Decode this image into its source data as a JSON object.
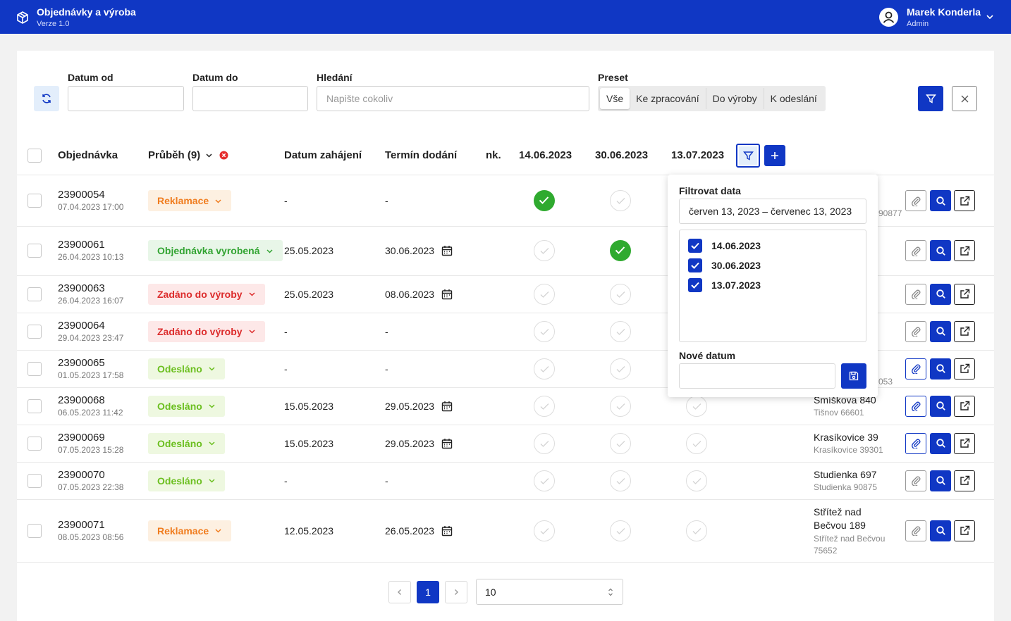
{
  "app": {
    "title": "Objednávky a výroba",
    "version": "Verze 1.0"
  },
  "user": {
    "name": "Marek Konderla",
    "role": "Admin"
  },
  "filters": {
    "date_from_label": "Datum od",
    "date_to_label": "Datum do",
    "search_label": "Hledání",
    "search_placeholder": "Napište cokoliv",
    "preset_label": "Preset",
    "presets": [
      "Vše",
      "Ke zpracování",
      "Do výroby",
      "K odeslání"
    ]
  },
  "table": {
    "headers": {
      "order": "Objednávka",
      "progress": "Průběh (9)",
      "start": "Datum zahájení",
      "due": "Termín dodání",
      "nk": "nk.",
      "d1": "14.06.2023",
      "d2": "30.06.2023",
      "d3": "13.07.2023"
    },
    "rows": [
      {
        "num": "23900054",
        "date": "07.04.2023 17:00",
        "status": "Reklamace",
        "start": "-",
        "due": "-",
        "checks": [
          true,
          false,
          null
        ],
        "addr": "",
        "addr2": "90877"
      },
      {
        "num": "23900061",
        "date": "26.04.2023 10:13",
        "status": "Objednávka vyrobená",
        "start": "25.05.2023",
        "due": "30.06.2023",
        "checks": [
          false,
          true,
          null
        ],
        "addr": "",
        "addr2": ""
      },
      {
        "num": "23900063",
        "date": "26.04.2023 16:07",
        "status": "Zadáno do výroby",
        "start": "25.05.2023",
        "due": "08.06.2023",
        "checks": [
          false,
          false,
          null
        ],
        "addr": "",
        "addr2": ""
      },
      {
        "num": "23900064",
        "date": "29.04.2023 23:47",
        "status": "Zadáno do výroby",
        "start": "-",
        "due": "-",
        "checks": [
          false,
          false,
          null
        ],
        "addr": "",
        "addr2": ""
      },
      {
        "num": "23900065",
        "date": "01.05.2023 17:58",
        "status": "Odesláno",
        "start": "-",
        "due": "-",
        "checks": [
          false,
          false,
          null
        ],
        "addr": "",
        "addr2": "053"
      },
      {
        "num": "23900068",
        "date": "06.05.2023 11:42",
        "status": "Odesláno",
        "start": "15.05.2023",
        "due": "29.05.2023",
        "checks": [
          false,
          false,
          false
        ],
        "addr": "Smíškova 840",
        "addr2": "Tišnov 66601"
      },
      {
        "num": "23900069",
        "date": "07.05.2023 15:28",
        "status": "Odesláno",
        "start": "15.05.2023",
        "due": "29.05.2023",
        "checks": [
          false,
          false,
          false
        ],
        "addr": "Krasíkovice 39",
        "addr2": "Krasíkovice 39301"
      },
      {
        "num": "23900070",
        "date": "07.05.2023 22:38",
        "status": "Odesláno",
        "start": "-",
        "due": "-",
        "checks": [
          false,
          false,
          false
        ],
        "addr": "Studienka 697",
        "addr2": "Studienka 90875"
      },
      {
        "num": "23900071",
        "date": "08.05.2023 08:56",
        "status": "Reklamace",
        "start": "12.05.2023",
        "due": "26.05.2023",
        "checks": [
          false,
          false,
          false
        ],
        "addr": "Střítež nad",
        "addr_b": "Bečvou 189",
        "addr2": "Střítež nad Bečvou",
        "addr2_b": "75652"
      }
    ]
  },
  "popup": {
    "filter_label": "Filtrovat data",
    "range_value": "červen 13, 2023 – červenec 13, 2023",
    "dates": [
      "14.06.2023",
      "30.06.2023",
      "13.07.2023"
    ],
    "new_date_label": "Nové datum"
  },
  "pagination": {
    "current_page": "1",
    "per_page": "10"
  },
  "colors": {
    "primary": "#1037c4",
    "success": "#2faa2f"
  }
}
